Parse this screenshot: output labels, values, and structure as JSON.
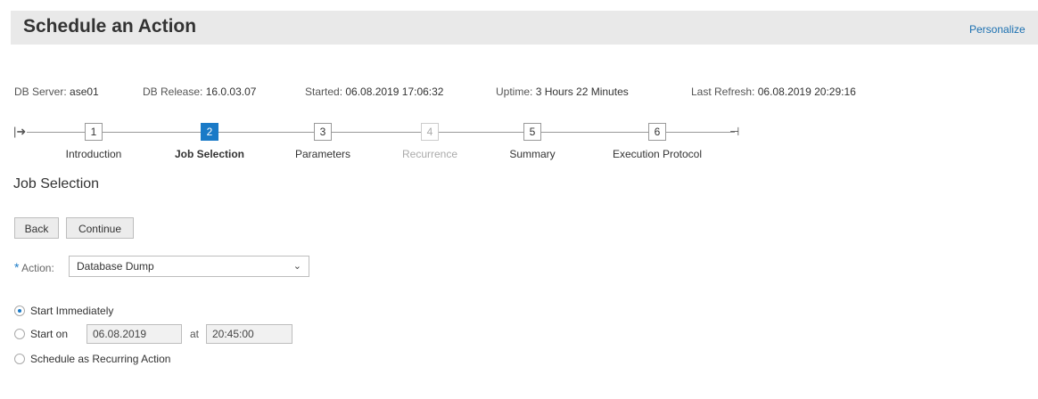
{
  "header": {
    "title": "Schedule an Action",
    "personalize": "Personalize"
  },
  "status": {
    "db_server_label": "DB Server:",
    "db_server_value": "ase01",
    "db_release_label": "DB Release:",
    "db_release_value": "16.0.03.07",
    "started_label": "Started:",
    "started_value": "06.08.2019 17:06:32",
    "uptime_label": "Uptime:",
    "uptime_value": "3  Hours 22  Minutes",
    "last_refresh_label": "Last Refresh:",
    "last_refresh_value": "06.08.2019 20:29:16"
  },
  "wizard": {
    "steps": [
      {
        "number": "1",
        "label": "Introduction",
        "state": "done"
      },
      {
        "number": "2",
        "label": "Job Selection",
        "state": "active"
      },
      {
        "number": "3",
        "label": "Parameters",
        "state": "enabled"
      },
      {
        "number": "4",
        "label": "Recurrence",
        "state": "disabled"
      },
      {
        "number": "5",
        "label": "Summary",
        "state": "enabled"
      },
      {
        "number": "6",
        "label": "Execution Protocol",
        "state": "enabled"
      }
    ]
  },
  "section": {
    "title": "Job Selection"
  },
  "buttons": {
    "back": "Back",
    "continue": "Continue"
  },
  "action": {
    "required_mark": "*",
    "label": "Action:",
    "selected": "Database Dump"
  },
  "schedule": {
    "options": [
      "Start Immediately",
      "Start on",
      "Schedule as Recurring Action"
    ],
    "selected_index": 0,
    "date": "06.08.2019",
    "at_label": "at",
    "time": "20:45:00"
  },
  "colors": {
    "accent": "#1a7ac7",
    "header_bg": "#e9e9e9",
    "link": "#1a6fb0"
  }
}
